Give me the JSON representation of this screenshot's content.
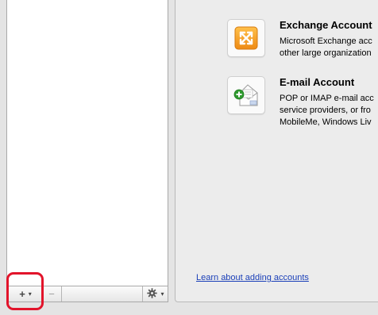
{
  "list_toolbar": {
    "add_label": "+",
    "add_caret": "▾",
    "remove_label": "−",
    "action_caret": "▾",
    "action_icon": "gear-icon"
  },
  "accounts": [
    {
      "title": "Exchange Account",
      "desc_line1": "Microsoft Exchange acc",
      "desc_line2": "other large organization",
      "desc_line3": "",
      "icon": "exchange-icon",
      "accent": "#f29a1f"
    },
    {
      "title": "E-mail Account",
      "desc_line1": "POP or IMAP e-mail acc",
      "desc_line2": "service providers, or fro",
      "desc_line3": "MobileMe, Windows Liv",
      "icon": "email-icon",
      "accent": "#2f9a2f"
    }
  ],
  "learn_link": "Learn about adding accounts",
  "colors": {
    "highlight": "#e2142b",
    "link": "#1a3fb8"
  }
}
